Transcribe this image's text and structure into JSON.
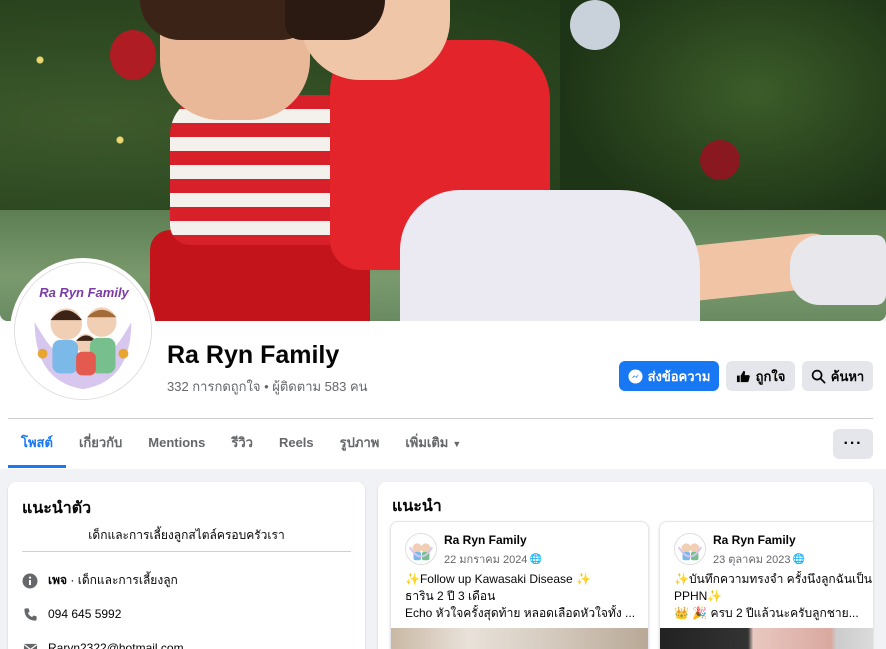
{
  "page": {
    "name": "Ra Ryn Family",
    "stats": "332 การกดถูกใจ • ผู้ติดตาม 583 คน",
    "avatar_text": "Ra Ryn Family"
  },
  "actions": {
    "message_label": "ส่งข้อความ",
    "like_label": "ถูกใจ",
    "search_label": "ค้นหา",
    "more_label": "···"
  },
  "tabs": [
    {
      "label": "โพสต์"
    },
    {
      "label": "เกี่ยวกับ"
    },
    {
      "label": "Mentions"
    },
    {
      "label": "รีวิว"
    },
    {
      "label": "Reels"
    },
    {
      "label": "รูปภาพ"
    },
    {
      "label": "เพิ่มเติม"
    }
  ],
  "intro": {
    "title": "แนะนำตัว",
    "bio": "เด็กและการเลี้ยงลูกสไตล์ครอบครัวเรา",
    "category_prefix": "เพจ",
    "category": " · เด็กและการเลี้ยงลูก",
    "phone": "094 645 5992",
    "email": "Raryn2322@hotmail.com"
  },
  "featured": {
    "title": "แนะนำ",
    "posts": [
      {
        "author": "Ra Ryn Family",
        "date": "22 มกราคม 2024",
        "line1": "✨Follow up Kawasaki Disease ✨",
        "line2": "ธาริน 2 ปี 3 เดือน",
        "line3": "Echo หัวใจครั้งสุดท้าย หลอดเลือดหัวใจทั้ง ..."
      },
      {
        "author": "Ra Ryn Family",
        "date": "23 ตุลาคม 2023",
        "line1": "✨บันทึกความทรงจำ ครั้งนึงลูกฉันเป็น",
        "line2": "PPHN✨",
        "line3": "👑 🎉 ครบ 2 ปีแล้วนะครับลูกชาย..."
      }
    ]
  },
  "colors": {
    "primary": "#1877f2",
    "secondary_bg": "#e4e6eb",
    "muted_text": "#65676b",
    "page_bg": "#f0f2f5"
  }
}
